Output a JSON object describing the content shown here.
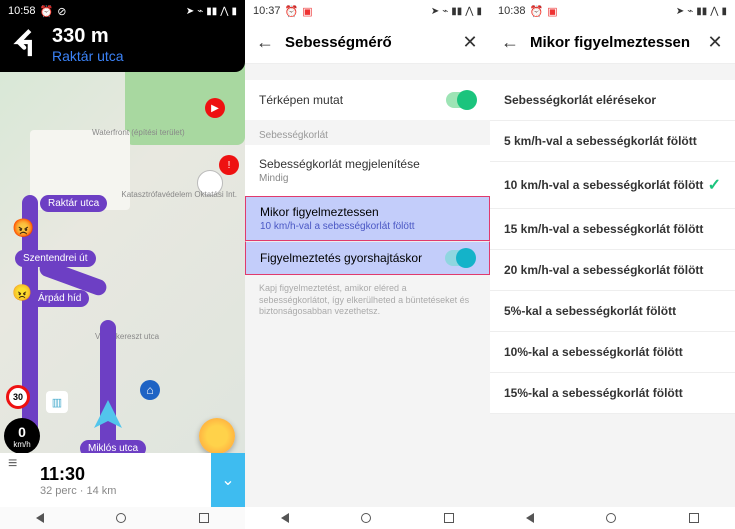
{
  "phone1": {
    "status_time": "10:58",
    "nav_distance": "330 m",
    "nav_street": "Raktár utca",
    "labels": {
      "raktar": "Raktár utca",
      "szentendrei": "Szentendrei út",
      "arpad": "Árpád híd",
      "miklos": "Miklós utca",
      "waterfront": "Waterfront (építési terület)",
      "katasztrofa": "Katasztrófavédelem Oktatási Int.",
      "voroskereszt": "Vöröskereszt utca"
    },
    "speed_limit": "30",
    "current_speed": "0",
    "speed_unit": "km/h",
    "eta_time": "11:30",
    "eta_duration": "32 perc",
    "eta_distance": "14 km"
  },
  "phone2": {
    "status_time": "10:37",
    "title": "Sebességmérő",
    "show_on_map": "Térképen mutat",
    "section_header": "Sebességkorlát",
    "show_limit": "Sebességkorlát megjelenítése",
    "show_limit_sub": "Mindig",
    "when_warn": "Mikor figyelmeztessen",
    "when_warn_sub": "10 km/h-val a sebességkorlát fölött",
    "speeding_alert": "Figyelmeztetés gyorshajtáskor",
    "helper": "Kapj figyelmeztetést, amikor eléred a sebességkorlátot, így elkerülheted a büntetéseket és biztonságosabban vezethetsz."
  },
  "phone3": {
    "status_time": "10:38",
    "title": "Mikor figyelmeztessen",
    "options": [
      "Sebességkorlát elérésekor",
      "5 km/h-val a sebességkorlát fölött",
      "10 km/h-val a sebességkorlát fölött",
      "15 km/h-val a sebességkorlát fölött",
      "20 km/h-val a sebességkorlát fölött",
      "5%-kal a sebességkorlát fölött",
      "10%-kal a sebességkorlát fölött",
      "15%-kal a sebességkorlát fölött"
    ],
    "selected_index": 2
  }
}
